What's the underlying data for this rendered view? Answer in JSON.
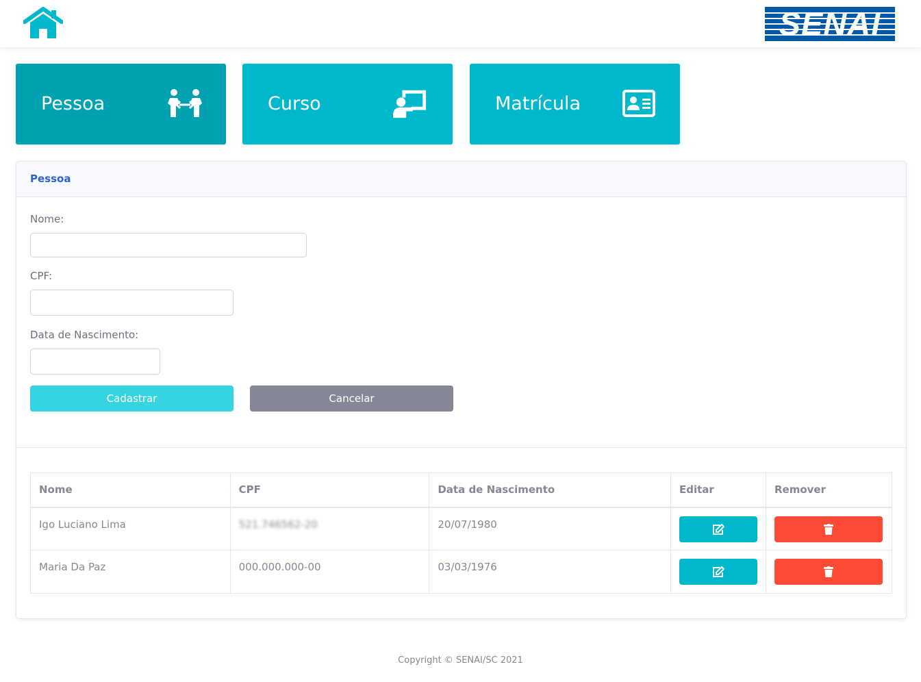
{
  "header": {
    "home_icon": "home-icon",
    "logo_text": "SENAI",
    "brand_color": "#0059a7"
  },
  "nav": [
    {
      "label": "Pessoa",
      "icon": "people-arrows-icon",
      "active": true
    },
    {
      "label": "Curso",
      "icon": "chalkboard-teacher-icon",
      "active": false
    },
    {
      "label": "Matrícula",
      "icon": "id-card-icon",
      "active": false
    }
  ],
  "form": {
    "title": "Pessoa",
    "fields": [
      {
        "label": "Nome:",
        "value": "",
        "placeholder": ""
      },
      {
        "label": "CPF:",
        "value": "",
        "placeholder": ""
      },
      {
        "label": "Data de Nascimento:",
        "value": "",
        "placeholder": ""
      }
    ],
    "submit_label": "Cadastrar",
    "cancel_label": "Cancelar"
  },
  "table": {
    "headers": [
      "Nome",
      "CPF",
      "Data de Nascimento",
      "Editar",
      "Remover"
    ],
    "rows": [
      {
        "nome": "Igo Luciano Lima",
        "cpf": "521.746562-20",
        "nascimento": "20/07/1980"
      },
      {
        "nome": "Maria Da Paz",
        "cpf": "000.000.000-00",
        "nascimento": "03/03/1976"
      }
    ],
    "edit_icon": "edit-icon",
    "delete_icon": "trash-icon"
  },
  "footer": {
    "text": "Copyright © SENAI/SC 2021"
  },
  "colors": {
    "accent": "#00b8cc",
    "accent_active": "#00a1b0",
    "danger": "#ff4a36",
    "secondary": "#858796",
    "primary_button": "#36d3e0"
  }
}
